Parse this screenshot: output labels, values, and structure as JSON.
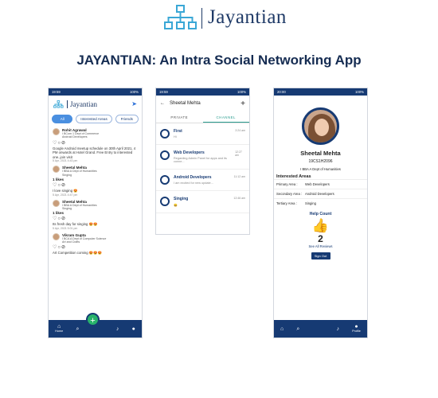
{
  "header": {
    "logo_text": "Jayantian",
    "title": "JAYANTIAN: An Intra Social Networking App"
  },
  "colors": {
    "navy": "#163a73",
    "accent": "#4a8fe0",
    "fab": "#28b36b",
    "teal": "#2a9d8f"
  },
  "status_time_1": "19:59",
  "status_time_2": "19:59",
  "status_time_3": "20:00",
  "status_right": "100%",
  "feed": {
    "logo": "Jayantian",
    "chips": [
      "All",
      "Interested Areas",
      "Friends"
    ],
    "posts": [
      {
        "name": "Rohit Agrawal",
        "sub1": "I BCom 1 Dept of Commerce",
        "sub2": "Android Developers",
        "body": "Google Android meetup schedule on 30th April 2021, 4 PM onwards at Hotel Grand. Free Entry to interested one..join visit",
        "time": "5 Apr, 2021 4:43 pm"
      },
      {
        "name": "Sheetal Mehta",
        "sub1": "I BBA A Dept of Humanities",
        "sub2": "Singing",
        "likes": "1 likes",
        "body": "I love singing",
        "time": "5 Apr, 2021 4:47 pm"
      },
      {
        "name": "Sheetal Mehta",
        "sub1": "I BBA A Dept of Humanities",
        "sub2": "Singing",
        "likes": "1 likes",
        "body": "Its fresh day for singing",
        "time": "5 Apr, 2021 5:01 pm"
      },
      {
        "name": "Vikram Gupta",
        "sub1": "I BCA A Dept of Computer Science",
        "sub2": "Art and Crafts",
        "body": "Art Competition coming"
      }
    ],
    "nav": [
      "Home",
      "",
      "",
      "",
      ""
    ]
  },
  "channels": {
    "title": "Sheetal Mehta",
    "tabs": [
      "PRIVATE",
      "CHANNEL"
    ],
    "items": [
      {
        "name": "First",
        "msg": "Hi",
        "time": "2:24 am"
      },
      {
        "name": "Web Developers",
        "msg": "Regarding Admin Panel for apps and its conne...",
        "time": "12:27 am"
      },
      {
        "name": "Android Developers",
        "msg": "I am excited for new update...",
        "time": "11:12 am"
      },
      {
        "name": "Singing",
        "msg": "",
        "time": "12:46 am"
      }
    ]
  },
  "profile": {
    "name": "Sheetal Mehta",
    "id": "19CS1H2096",
    "dept": "I BBA A Dept of Humanities",
    "section": "Interested Areas",
    "rows": [
      {
        "label": "Primary Area :",
        "value": "Web Developers"
      },
      {
        "label": "Secondary Area :",
        "value": "Android Developers"
      },
      {
        "label": "Tertiary Area :",
        "value": "Singing"
      }
    ],
    "help_count_label": "Help Count",
    "count": "2",
    "see_reviews": "See All Reviews",
    "sign_out": "Sign Out",
    "nav_profile": "Profile"
  }
}
